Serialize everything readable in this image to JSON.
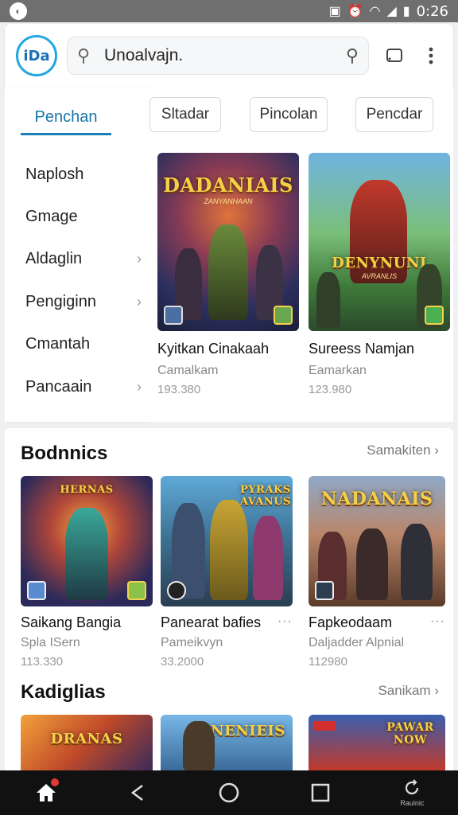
{
  "status_bar": {
    "time": "0:26"
  },
  "header": {
    "logo_text": "iDa",
    "search_value": "Unoalvajn.",
    "cast_icon": "cast-icon",
    "menu_icon": "more-vert-icon"
  },
  "drawer": {
    "active_tab": "Penchan",
    "items": [
      {
        "label": "Naplosh",
        "chevron": false
      },
      {
        "label": "Gmage",
        "chevron": false
      },
      {
        "label": "Aldaglin",
        "chevron": true
      },
      {
        "label": "Pengiginn",
        "chevron": true
      },
      {
        "label": "Cmantah",
        "chevron": false
      },
      {
        "label": "Pancaain",
        "chevron": true
      }
    ]
  },
  "chips": [
    "Sltadar",
    "Pincolan",
    "Pencdar"
  ],
  "featured": [
    {
      "art_title": "DADANIAIS",
      "art_sub": "ZANYANHAAN",
      "title": "Kyitkan Cinakaah",
      "subtitle": "Camalkam",
      "count": "193.380"
    },
    {
      "art_title": "DENYNUNI",
      "art_sub": "AVRANLIS",
      "title": "Sureess Namjan",
      "subtitle": "Eamarkan",
      "count": "123.980"
    }
  ],
  "sections": [
    {
      "title": "Bodnnics",
      "link": "Samakiten",
      "cards": [
        {
          "art_title": "HERNAS",
          "title": "Saikang Bangia",
          "subtitle": "Spla ISern",
          "count": "113.330",
          "dots": false
        },
        {
          "art_title": "PYRAKS AVANUS",
          "title": "Panearat bafies",
          "subtitle": "Pameikvyn",
          "count": "33.2000",
          "dots": true
        },
        {
          "art_title": "NADANAIS",
          "title": "Fapkeodaam",
          "subtitle": "Daljadder Alpnial",
          "count": "112980",
          "dots": true
        }
      ]
    },
    {
      "title": "Kadiglias",
      "link": "Sanikam",
      "cards": [
        {
          "art_title": "DRANAS"
        },
        {
          "art_title": "NENIEIS"
        },
        {
          "art_title": "PAWAR NOW"
        }
      ]
    }
  ],
  "navbar": {
    "last_label": "Rauinic"
  }
}
